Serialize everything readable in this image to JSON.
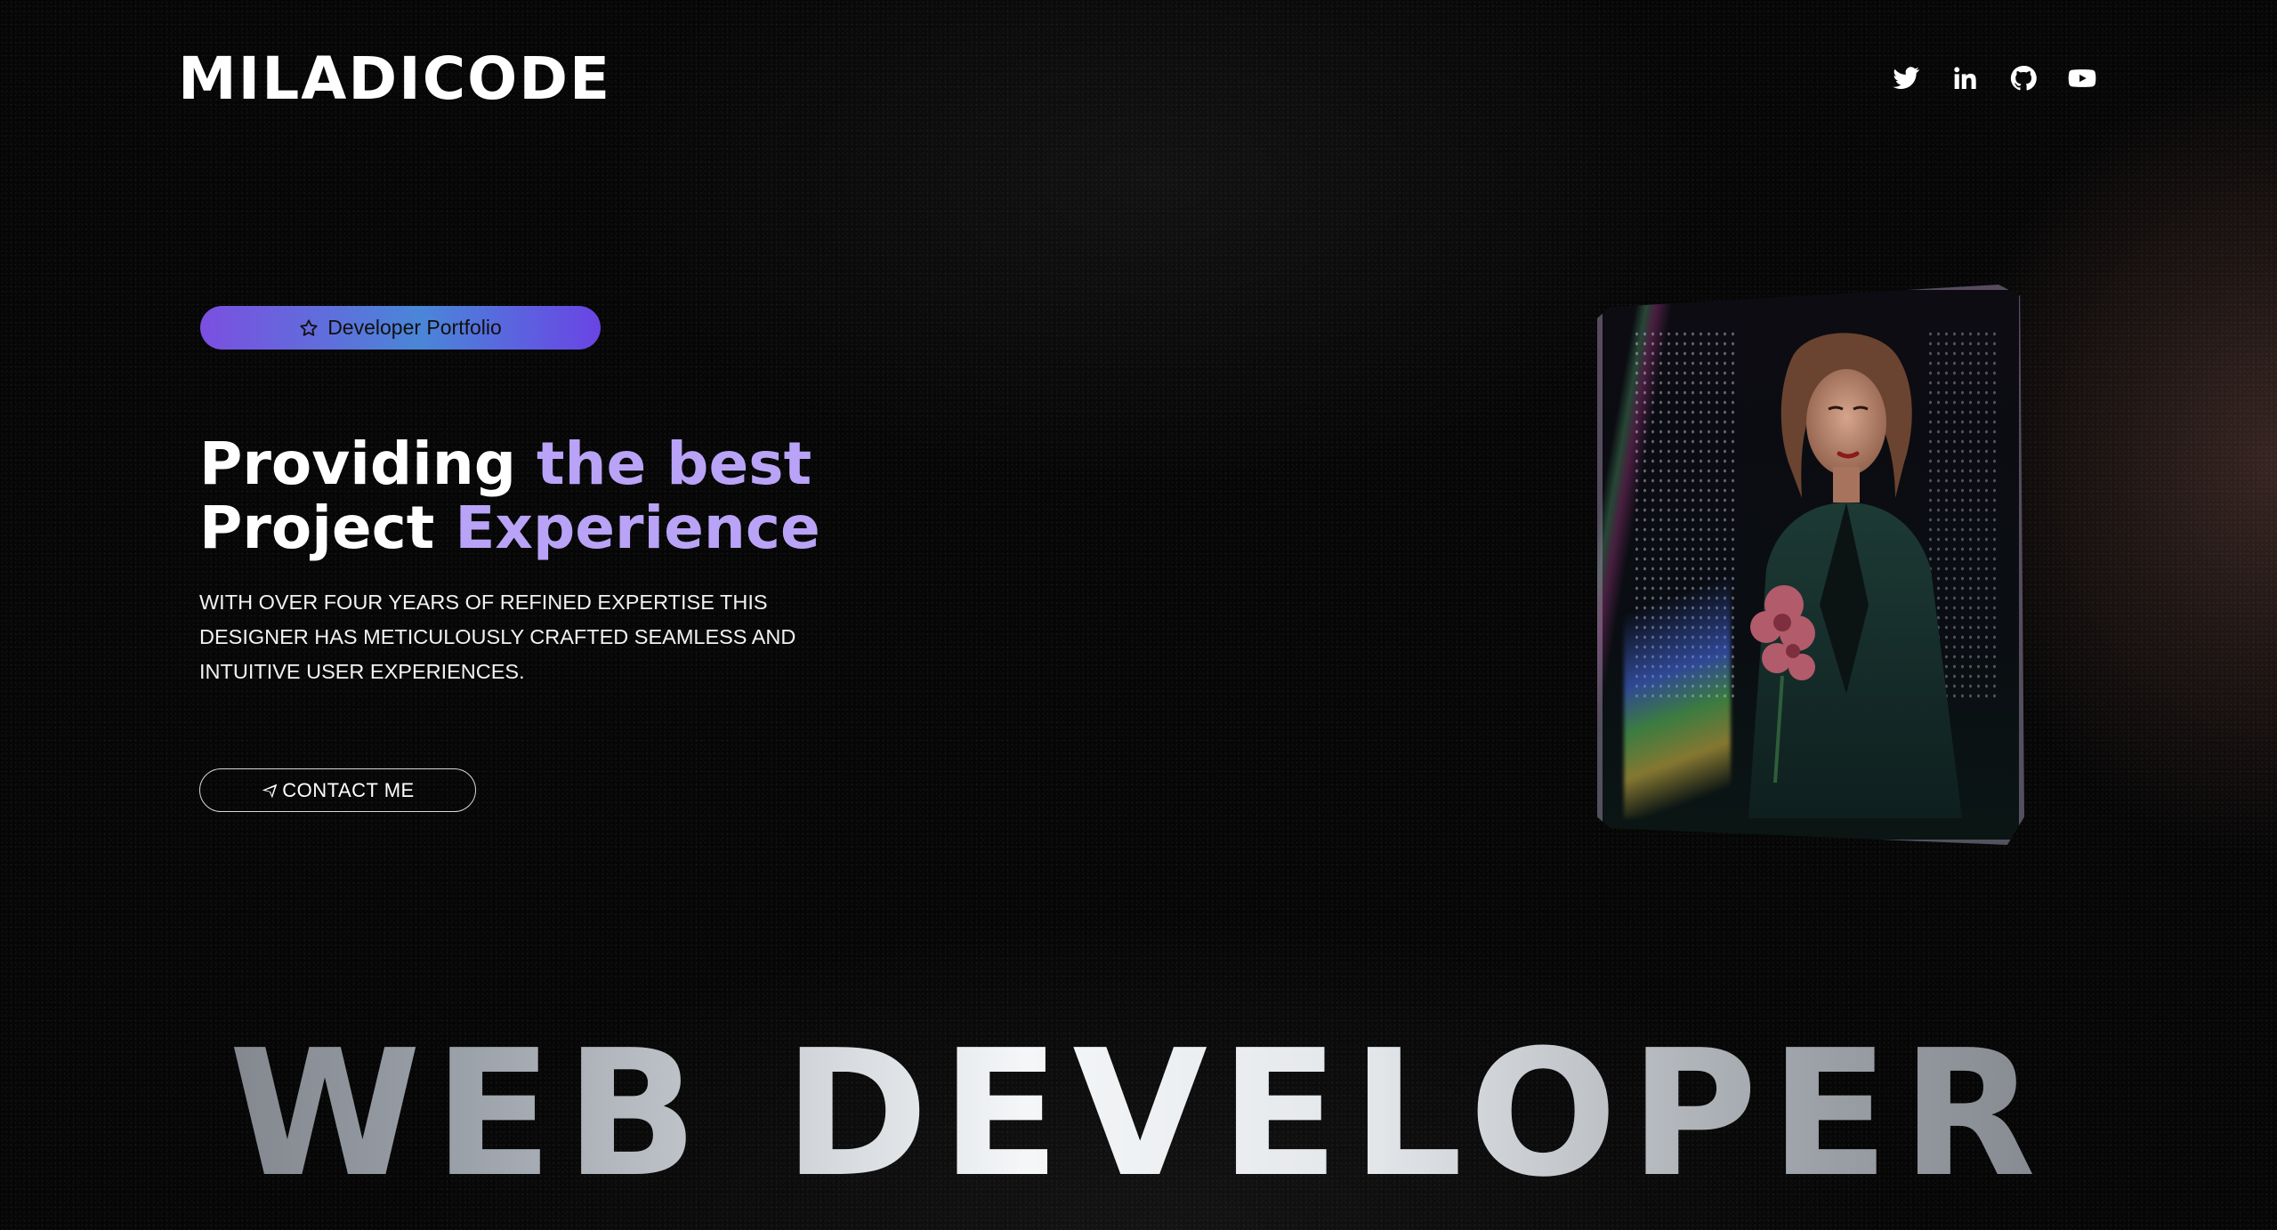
{
  "header": {
    "logo": "MILADICODE",
    "socials": [
      {
        "name": "twitter",
        "icon": "twitter-icon"
      },
      {
        "name": "linkedin",
        "icon": "linkedin-icon"
      },
      {
        "name": "github",
        "icon": "github-icon"
      },
      {
        "name": "youtube",
        "icon": "youtube-icon"
      }
    ]
  },
  "hero": {
    "badge": {
      "label": "Developer Portfolio",
      "icon": "star-icon"
    },
    "headline": {
      "line1_part1": "Providing",
      "line1_part2": "the best",
      "line2_part1": "Project",
      "line2_part2": "Experience"
    },
    "description": "WITH OVER FOUR YEARS OF REFINED EXPERTISE THIS DESIGNER HAS METICULOUSLY CRAFTED SEAMLESS AND INTUITIVE USER EXPERIENCES.",
    "cta": {
      "label": "CONTACT ME",
      "icon": "send-icon"
    }
  },
  "banner": {
    "text": "WEB DEVELOPER"
  },
  "colors": {
    "accent": "#b9a3f6",
    "badge_gradient_start": "#7b4fe0",
    "badge_gradient_mid": "#4a86d8",
    "background": "#060606"
  }
}
